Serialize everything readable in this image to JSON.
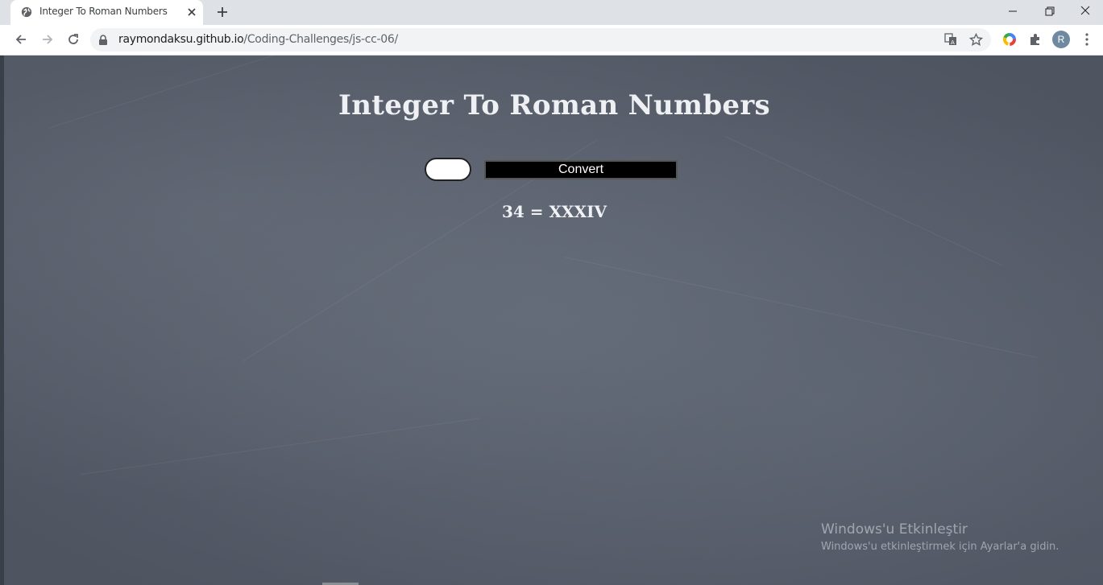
{
  "tab": {
    "title": "Integer To Roman Numbers"
  },
  "address_bar": {
    "domain": "raymondaksu.github.io",
    "path": "/Coding-Challenges/js-cc-06/"
  },
  "profile": {
    "initial": "R"
  },
  "page": {
    "heading": "Integer To Roman Numbers",
    "input": {
      "value": "",
      "placeholder": ""
    },
    "convert_label": "Convert",
    "result": "34 = XXXIV"
  },
  "watermark": {
    "line1": "Windows'u Etkinleştir",
    "line2": "Windows'u etkinleştirmek için Ayarlar'a gidin."
  },
  "colors": {
    "background": "#565c68",
    "button": "#000000",
    "heading": "#eef0f3"
  }
}
